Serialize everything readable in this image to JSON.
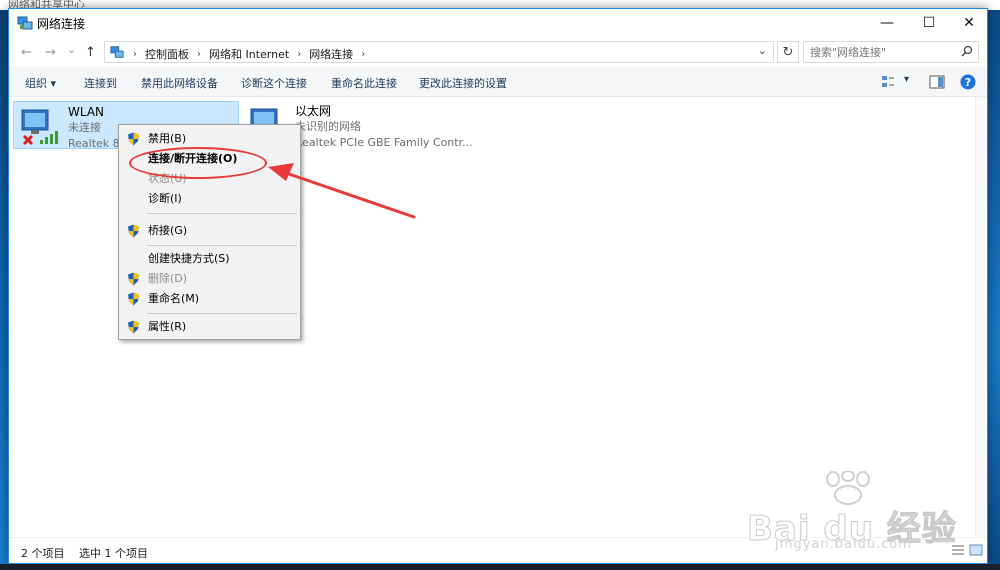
{
  "background_window": {
    "title": "网络和共享中心"
  },
  "window": {
    "title": "网络连接",
    "controls": {
      "minimize": "—",
      "maximize": "☐",
      "close": "✕"
    }
  },
  "navigation": {
    "back": "←",
    "forward": "→",
    "recent": "⌄",
    "up": "↑",
    "breadcrumb": [
      "控制面板",
      "网络和 Internet",
      "网络连接"
    ],
    "address_dropdown": "⌄",
    "refresh": "↻",
    "search_placeholder": "搜索\"网络连接\""
  },
  "toolbar": {
    "items": [
      "组织 ▾",
      "连接到",
      "禁用此网络设备",
      "诊断这个连接",
      "重命名此连接",
      "更改此连接的设置"
    ],
    "view_dropdown": "▾"
  },
  "connections": [
    {
      "name": "WLAN",
      "status": "未连接",
      "device": "Realtek 8",
      "selected": true
    },
    {
      "name": "以太网",
      "status": "未识别的网络",
      "device": "Realtek PCIe GBE Family Contr...",
      "selected": false
    }
  ],
  "context_menu": {
    "items": [
      {
        "label": "禁用(B)",
        "shield": true,
        "disabled": false,
        "bold": false
      },
      {
        "label": "连接/断开连接(O)",
        "shield": false,
        "disabled": false,
        "bold": true
      },
      {
        "label": "状态(U)",
        "shield": false,
        "disabled": true,
        "bold": false
      },
      {
        "label": "诊断(I)",
        "shield": false,
        "disabled": false,
        "bold": false
      },
      {
        "label": "桥接(G)",
        "shield": true,
        "disabled": false,
        "bold": false
      },
      {
        "label": "创建快捷方式(S)",
        "shield": false,
        "disabled": false,
        "bold": false
      },
      {
        "label": "删除(D)",
        "shield": true,
        "disabled": true,
        "bold": false
      },
      {
        "label": "重命名(M)",
        "shield": true,
        "disabled": false,
        "bold": false
      },
      {
        "label": "属性(R)",
        "shield": true,
        "disabled": false,
        "bold": false
      }
    ]
  },
  "status_bar": {
    "count": "2 个项目",
    "selection": "选中 1 个项目"
  },
  "watermark": {
    "brand": "Bai du 经验",
    "url": "jingyan.baidu.com"
  },
  "colors": {
    "accent": "#1e88e5",
    "selection": "#cce8ff",
    "annotation": "#e83a3a",
    "help": "#1a73d9"
  },
  "icons": [
    "network-connections-icon",
    "search-icon",
    "help-icon",
    "shield-icon",
    "wlan-adapter-icon",
    "ethernet-adapter-icon",
    "preview-pane-icon",
    "view-options-icon",
    "details-view-icon",
    "large-icons-view-icon"
  ]
}
